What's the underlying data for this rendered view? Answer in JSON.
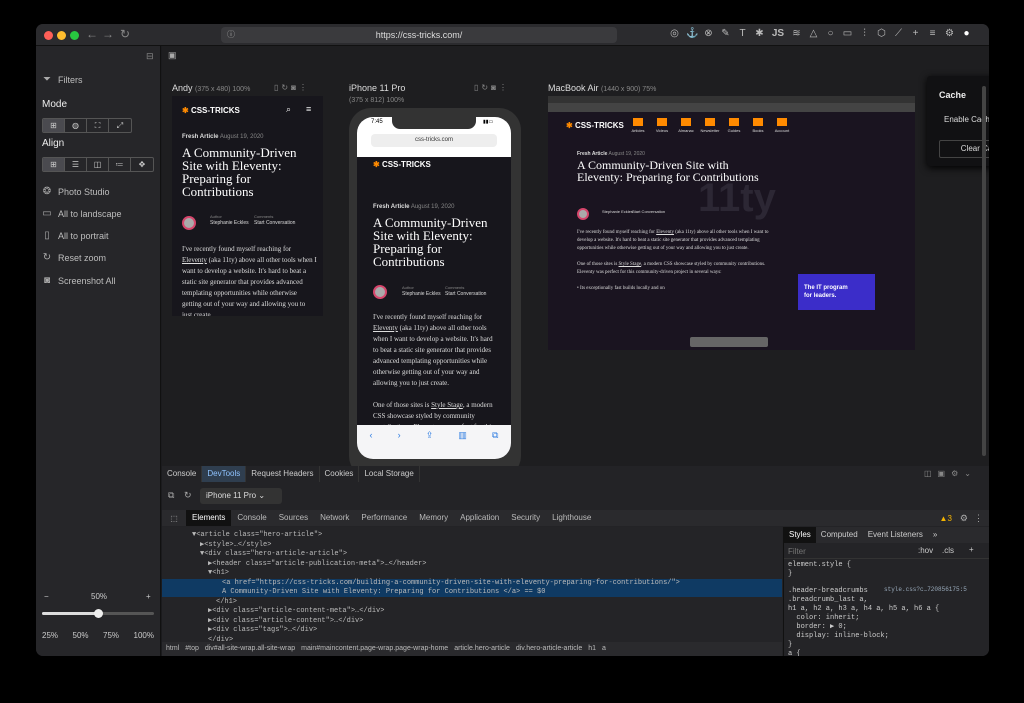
{
  "browser": {
    "url": "https://css-tricks.com/"
  },
  "sidebar": {
    "filters": "Filters",
    "mode": "Mode",
    "align": "Align",
    "actions": [
      "Photo Studio",
      "All to landscape",
      "All to portrait",
      "Reset zoom",
      "Screenshot All"
    ],
    "zoom_value": "50%",
    "zoom_minus": "−",
    "zoom_plus": "+",
    "zoom_presets": [
      "25%",
      "50%",
      "75%",
      "100%"
    ],
    "zoom_level": 0.5
  },
  "devices": {
    "andy": {
      "name": "Andy",
      "size": "(375 x 480) 100%"
    },
    "iphone": {
      "name": "iPhone 11 Pro",
      "size": "(375 x 812) 100%",
      "time": "7:45",
      "url": "css-tricks.com"
    },
    "macbook": {
      "name": "MacBook Air",
      "size": "(1440 x 900) 75%"
    }
  },
  "article": {
    "logo": "CSS-TRICKS",
    "category": "Fresh Article",
    "date": "August 19, 2020",
    "title": "A Community-Driven Site with Eleventy: Preparing for Contributions",
    "author_label": "Author",
    "author": "Stephanie Eckles",
    "comments_label": "Comments",
    "comments": "Start Conversation",
    "p1a": "I've recently found myself reaching for ",
    "p1link": "Eleventy",
    "p1b": " (aka 11ty) above all other tools when I want to develop a website. It's hard to beat a static site generator that provides advanced templating opportunities while otherwise getting out of your way and allowing you to just create.",
    "p2a": "One of those sites is ",
    "p2link": "Style Stage",
    "p2b": ", a modern CSS showcase styled by community contributions. Eleventy was perfect for this community-driven project in several ways:",
    "bullet": "Its exceptionally fast builds locally and on"
  },
  "macbook_nav": [
    "Articles",
    "Videos",
    "Almanac",
    "Newsletter",
    "Guides",
    "Books",
    "Account"
  ],
  "macbook_ad": {
    "line1": "The IT program",
    "line2": "for leaders."
  },
  "cache": {
    "title": "Cache",
    "enable_label": "Enable Cache",
    "enabled": true,
    "clear": "Clear Cache"
  },
  "devtools": {
    "top_tabs": [
      "Console",
      "DevTools",
      "Request Headers",
      "Cookies",
      "Local Storage"
    ],
    "device_select": "iPhone 11 Pro",
    "panel_tabs": [
      "Elements",
      "Console",
      "Sources",
      "Network",
      "Performance",
      "Memory",
      "Application",
      "Security",
      "Lighthouse"
    ],
    "warnings": "3",
    "code": [
      {
        "t": "▼<article class=\"hero-article\">",
        "indent": 30
      },
      {
        "t": "▶<style>…</style>",
        "indent": 38
      },
      {
        "t": "▼<div class=\"hero-article-article\">",
        "indent": 38
      },
      {
        "t": "▶<header class=\"article-publication-meta\">…</header>",
        "indent": 46
      },
      {
        "t": "▼<h1>",
        "indent": 46
      },
      {
        "t": "<a href=\"https://css-tricks.com/building-a-community-driven-site-with-eleventy-preparing-for-contributions/\">",
        "indent": 60,
        "sel": true
      },
      {
        "t": "A Community-Driven Site with Eleventy: Preparing for Contributions </a> == $0",
        "indent": 60,
        "sel": true
      },
      {
        "t": "</h1>",
        "indent": 54
      },
      {
        "t": "▶<div class=\"article-content-meta\">…</div>",
        "indent": 46
      },
      {
        "t": "▶<div class=\"article-content\">…</div>",
        "indent": 46
      },
      {
        "t": "▶<div class=\"tags\">…</div>",
        "indent": 46
      },
      {
        "t": "</div>",
        "indent": 46
      }
    ],
    "breadcrumbs": [
      "html",
      "#top",
      "div#all-site-wrap.all-site-wrap",
      "main#maincontent.page-wrap.page-wrap-home",
      "article.hero-article",
      "div.hero-article-article",
      "h1",
      "a"
    ],
    "styles_tabs": [
      "Styles",
      "Computed",
      "Event Listeners"
    ],
    "filter_placeholder": "Filter",
    "hov": ":hov",
    "cls": ".cls",
    "style_lines": [
      "element.style {",
      "}",
      ".header-breadcrumbs",
      ".breadcrumb_last a,",
      "h1 a, h2 a, h3 a, h4 a, h5 a, h6 a {",
      "  color: inherit;",
      "  border: ▶ 0;",
      "  display: inline-block;",
      "}",
      "a {"
    ],
    "style_source": "style.css?c…720856175:5"
  }
}
